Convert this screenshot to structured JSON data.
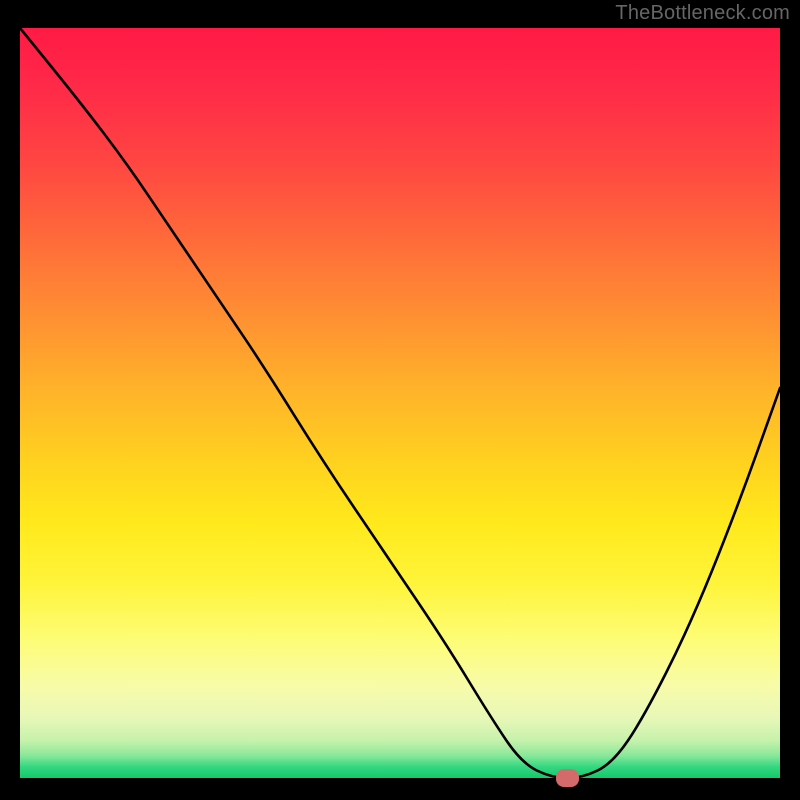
{
  "watermark": "TheBottleneck.com",
  "chart_data": {
    "type": "line",
    "title": "",
    "xlabel": "",
    "ylabel": "",
    "xlim": [
      0,
      100
    ],
    "ylim": [
      0,
      100
    ],
    "grid": false,
    "series": [
      {
        "name": "curve",
        "x": [
          0,
          8,
          14,
          20,
          26,
          32,
          40,
          48,
          56,
          62,
          66,
          70,
          74,
          78,
          82,
          88,
          94,
          100
        ],
        "y": [
          100,
          90,
          82,
          73,
          64,
          55,
          42,
          30,
          18,
          8,
          2,
          0,
          0,
          2,
          8,
          20,
          35,
          52
        ]
      }
    ],
    "marker": {
      "x": 72,
      "y": 0,
      "width": 3,
      "height": 1.5,
      "color": "#d46a6a"
    },
    "gradient_stops": [
      {
        "pos": 0,
        "color": "#ff1a45"
      },
      {
        "pos": 50,
        "color": "#ffc225"
      },
      {
        "pos": 80,
        "color": "#fdfd7a"
      },
      {
        "pos": 100,
        "color": "#13c96c"
      }
    ]
  }
}
